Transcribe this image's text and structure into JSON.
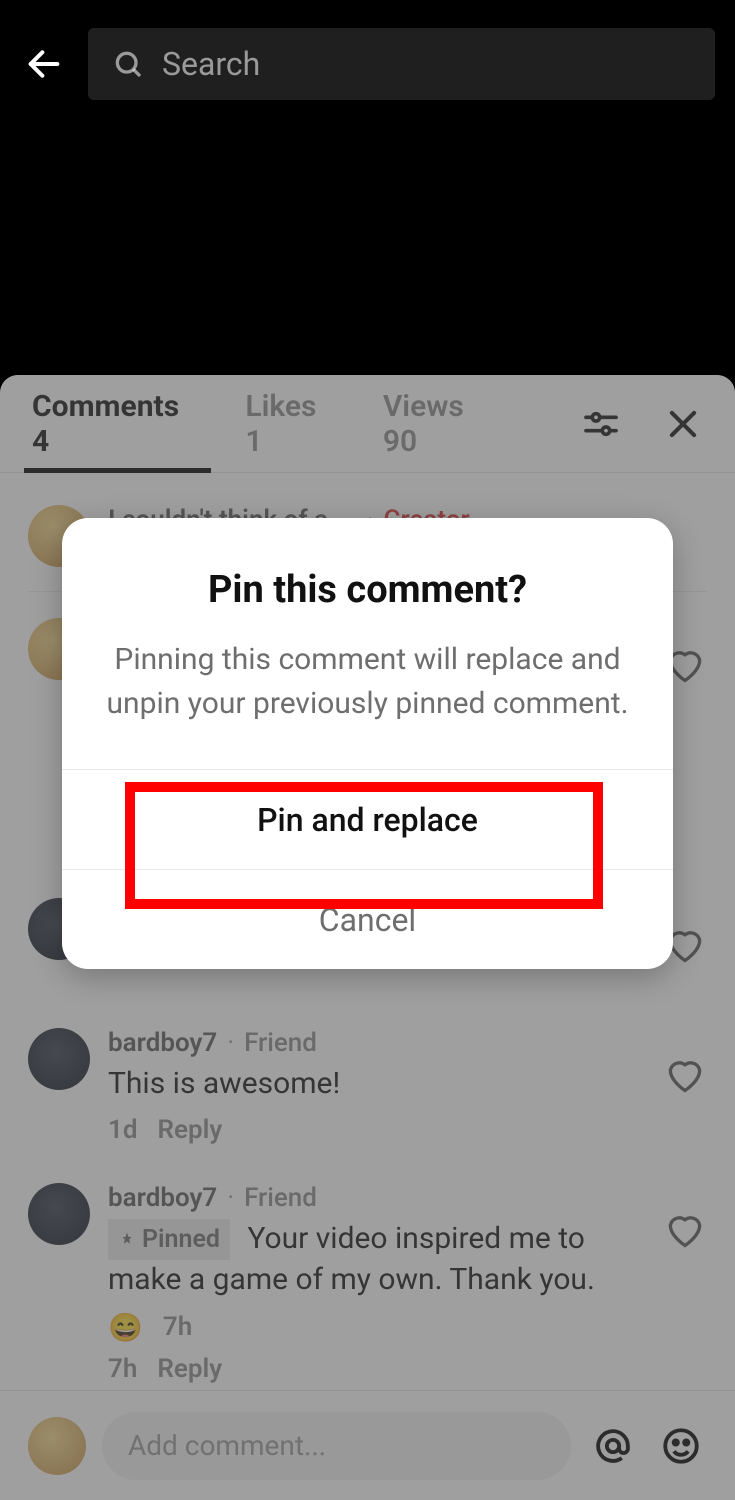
{
  "search_placeholder": "Search",
  "tabs": {
    "comments": "Comments 4",
    "likes": "Likes 1",
    "views": "Views 90"
  },
  "comments": [
    {
      "username": "I couldn't think of a ...",
      "tag": "Creator"
    },
    {
      "username": "bardboy7",
      "tag": "Friend",
      "text": "This is awesome!",
      "time": "1d",
      "reply": "Reply"
    },
    {
      "username": "bardboy7",
      "tag": "Friend",
      "pinned_label": "Pinned",
      "text": "Your video inspired me to make a game of my own. Thank you.",
      "emoji_time": "7h",
      "time": "7h",
      "reply": "Reply"
    }
  ],
  "input_placeholder": "Add comment...",
  "dialog": {
    "title": "Pin this comment?",
    "description": "Pinning this comment will replace and unpin your previously pinned comment.",
    "primary": "Pin and replace",
    "cancel": "Cancel"
  }
}
